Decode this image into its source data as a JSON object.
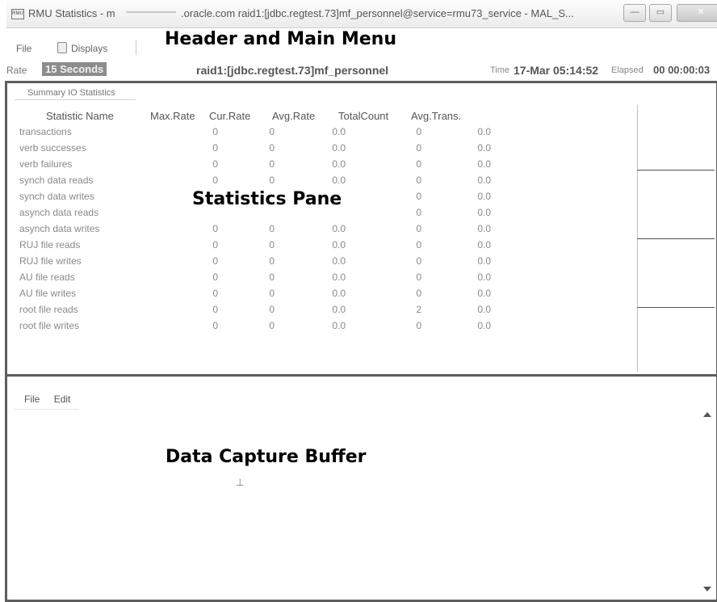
{
  "window": {
    "title_prefix": "RMU Statistics - m",
    "title_rest": ".oracle.com raid1:[jdbc.regtest.73]mf_personnel@service=rmu73_service - MAL_S...",
    "app_icon": "rmu-app-icon",
    "controls": {
      "minimize": "—",
      "maximize": "▭",
      "close": "✕"
    }
  },
  "menu": {
    "file": "File",
    "displays": "Displays"
  },
  "status": {
    "rate_label": "Rate",
    "rate_value": "15 Seconds",
    "database": "raid1:[jdbc.regtest.73]mf_personnel",
    "time_label": "Time",
    "time_value": "17-Mar 05:14:52",
    "elapsed_label": "Elapsed",
    "elapsed_value": "00 00:00:03"
  },
  "annotations": {
    "header": "Header and Main Menu",
    "stats": "Statistics Pane",
    "buffer": "Data Capture Buffer"
  },
  "stats": {
    "tab": "Summary IO Statistics",
    "columns": [
      "Statistic Name",
      "Max.Rate",
      "Cur.Rate",
      "Avg.Rate",
      "TotalCount",
      "Avg.Trans."
    ],
    "rows": [
      [
        "transactions",
        "0",
        "0",
        "0.0",
        "0",
        "0.0"
      ],
      [
        "verb successes",
        "0",
        "0",
        "0.0",
        "0",
        "0.0"
      ],
      [
        "verb failures",
        "0",
        "0",
        "0.0",
        "0",
        "0.0"
      ],
      [
        "synch data reads",
        "0",
        "0",
        "0.0",
        "0",
        "0.0"
      ],
      [
        "synch data writes",
        "",
        "",
        "",
        "0",
        "0.0"
      ],
      [
        "asynch data reads",
        "",
        "",
        "",
        "0",
        "0.0"
      ],
      [
        "asynch data writes",
        "0",
        "0",
        "0.0",
        "0",
        "0.0"
      ],
      [
        "RUJ file reads",
        "0",
        "0",
        "0.0",
        "0",
        "0.0"
      ],
      [
        "RUJ file writes",
        "0",
        "0",
        "0.0",
        "0",
        "0.0"
      ],
      [
        "AU file reads",
        "0",
        "0",
        "0.0",
        "0",
        "0.0"
      ],
      [
        "AU file writes",
        "0",
        "0",
        "0.0",
        "0",
        "0.0"
      ],
      [
        "root file reads",
        "0",
        "0",
        "0.0",
        "2",
        "0.0"
      ],
      [
        "root file writes",
        "0",
        "0",
        "0.0",
        "0",
        "0.0"
      ]
    ]
  },
  "buffer": {
    "menu": [
      "File",
      "Edit"
    ],
    "cursor": "⊥"
  }
}
